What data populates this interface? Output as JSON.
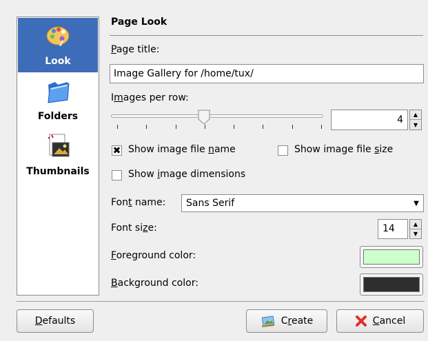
{
  "sidebar": {
    "items": [
      {
        "label": "Look",
        "icon": "palette-icon",
        "selected": true
      },
      {
        "label": "Folders",
        "icon": "folder-icon",
        "selected": false
      },
      {
        "label": "Thumbnails",
        "icon": "thumbnails-image-icon",
        "selected": false
      }
    ]
  },
  "section_title": "Page Look",
  "page_title": {
    "mnemonic": "P",
    "label_rest": "age title:",
    "value": "Image Gallery for /home/tux/"
  },
  "images_per_row": {
    "label_pre": "I",
    "mnemonic": "m",
    "label_post": "ages per row:",
    "value": "4",
    "slider_min": 1,
    "slider_max": 8,
    "slider_value": 4
  },
  "checkboxes": {
    "show_name": {
      "pre": "Show image file ",
      "mnemonic": "n",
      "post": "ame",
      "checked": true
    },
    "show_size": {
      "pre": "Show image file ",
      "mnemonic": "s",
      "post": "ize",
      "checked": false
    },
    "show_dims": {
      "pre": "Show ",
      "mnemonic": "i",
      "post": "mage dimensions",
      "checked": false
    }
  },
  "font_name": {
    "pre": "Fon",
    "mnemonic": "t",
    "post": " name:",
    "value": "Sans Serif"
  },
  "font_size": {
    "pre": "Font si",
    "mnemonic": "z",
    "post": "e:",
    "value": "14"
  },
  "foreground": {
    "mnemonic": "F",
    "post": "oreground color:",
    "color": "#ccffcc"
  },
  "background": {
    "mnemonic": "B",
    "post": "ackground color:",
    "color": "#2e2e2e"
  },
  "buttons": {
    "defaults": {
      "mnemonic": "D",
      "post": "efaults"
    },
    "create": {
      "pre": "C",
      "mnemonic": "r",
      "post": "eate"
    },
    "cancel": {
      "mnemonic": "C",
      "post": "ancel"
    }
  },
  "colors": {
    "selection": "#3d6cb8",
    "cancel_icon": "#e0302a"
  }
}
